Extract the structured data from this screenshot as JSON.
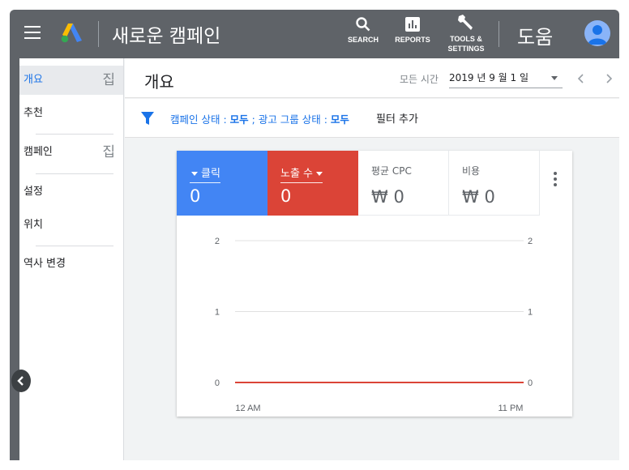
{
  "topbar": {
    "title": "새로운 캠페인",
    "tools": [
      {
        "icon": "search-icon",
        "label": "SEARCH"
      },
      {
        "icon": "reports-icon",
        "label": "REPORTS"
      },
      {
        "icon": "wrench-icon",
        "label_line1": "TOOLS &",
        "label_line2": "SETTINGS"
      }
    ],
    "help_label": "도움"
  },
  "sidebar": {
    "items": [
      {
        "label": "개요",
        "mark": "집"
      },
      {
        "label": "추천",
        "mark": ""
      },
      {
        "label": "캠페인",
        "mark": "집"
      },
      {
        "label": "설정",
        "mark": ""
      },
      {
        "label": "위치",
        "mark": ""
      },
      {
        "label": "역사 변경",
        "mark": ""
      }
    ]
  },
  "header": {
    "title": "개요",
    "date_label": "모든 시간",
    "date_value": "2019 년 9 월 1 일"
  },
  "filter": {
    "part1": "캠페인 상태 : ",
    "part1_value": "모두",
    "part2": " ; 광고 그룹 상태 : ",
    "part2_value": "모두",
    "add_filter": "필터 추가"
  },
  "metrics": [
    {
      "name": "클릭",
      "value": "0",
      "color": "#4285f4"
    },
    {
      "name": "노출 수",
      "value": "0",
      "color": "#db4437"
    },
    {
      "name": "평균 CPC",
      "value": "₩ 0"
    },
    {
      "name": "비용",
      "value": "₩ 0"
    }
  ],
  "chart_data": {
    "type": "line",
    "x_labels": [
      "12 AM",
      "11 PM"
    ],
    "y_ticks_left": [
      "0",
      "1",
      "2"
    ],
    "y_ticks_right": [
      "0",
      "1",
      "2"
    ],
    "ylim": [
      0,
      2
    ],
    "series": [
      {
        "values": [
          0,
          0
        ],
        "color": "#db4437"
      },
      {
        "values": [
          0,
          0
        ],
        "color": "#4285f4"
      }
    ],
    "grid": true
  }
}
